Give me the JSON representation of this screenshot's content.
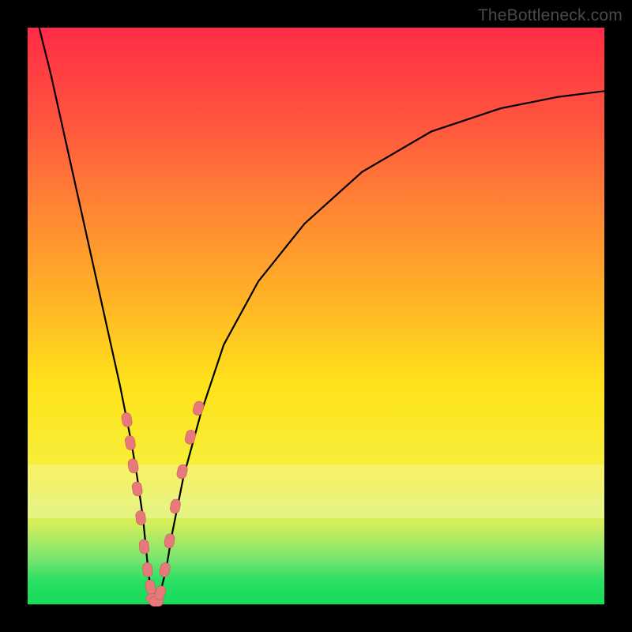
{
  "watermark": "TheBottleneck.com",
  "colors": {
    "gradient_top": "#ff2b47",
    "gradient_bottom": "#16db5a",
    "curve_stroke": "#000000",
    "marker_fill": "#e67a7a",
    "marker_stroke": "#c95c5c"
  },
  "chart_data": {
    "type": "line",
    "title": "",
    "xlabel": "",
    "ylabel": "",
    "xlim": [
      0,
      100
    ],
    "ylim": [
      0,
      100
    ],
    "grid": false,
    "series": [
      {
        "name": "bottleneck-curve",
        "x": [
          2,
          4,
          6,
          8,
          10,
          12,
          14,
          16,
          17,
          18,
          19,
          20,
          20.5,
          21,
          21.5,
          22,
          23,
          24,
          25,
          27,
          30,
          34,
          40,
          48,
          58,
          70,
          82,
          92,
          100
        ],
        "values": [
          100,
          92,
          83,
          74,
          65,
          56,
          47,
          38,
          33,
          28,
          22,
          15,
          10,
          5,
          2,
          0,
          2,
          6,
          12,
          22,
          33,
          45,
          56,
          66,
          75,
          82,
          86,
          88,
          89
        ]
      }
    ],
    "markers": [
      {
        "x": 17.2,
        "y": 32
      },
      {
        "x": 17.8,
        "y": 28
      },
      {
        "x": 18.3,
        "y": 24
      },
      {
        "x": 19.0,
        "y": 20
      },
      {
        "x": 19.6,
        "y": 15
      },
      {
        "x": 20.2,
        "y": 10
      },
      {
        "x": 20.8,
        "y": 6
      },
      {
        "x": 21.3,
        "y": 3
      },
      {
        "x": 21.8,
        "y": 1
      },
      {
        "x": 22.3,
        "y": 0.5
      },
      {
        "x": 23.0,
        "y": 2
      },
      {
        "x": 23.8,
        "y": 6
      },
      {
        "x": 24.6,
        "y": 11
      },
      {
        "x": 25.6,
        "y": 17
      },
      {
        "x": 26.8,
        "y": 23
      },
      {
        "x": 28.2,
        "y": 29
      },
      {
        "x": 29.6,
        "y": 34
      }
    ],
    "annotations": []
  }
}
